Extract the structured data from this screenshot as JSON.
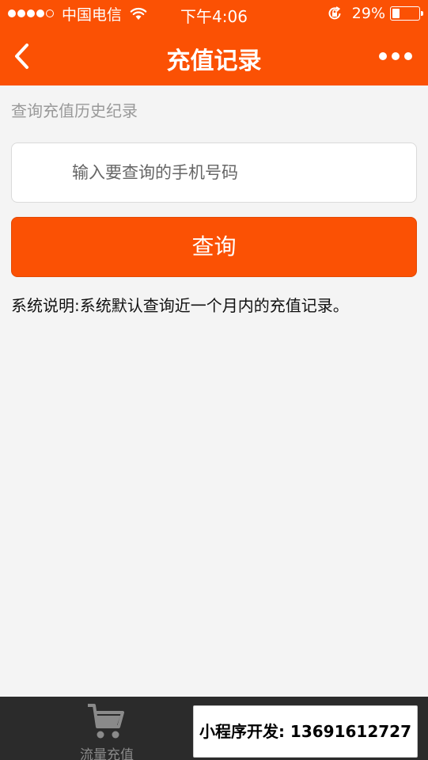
{
  "status_bar": {
    "carrier": "中国电信",
    "time": "下午4:06",
    "battery_percent": "29%",
    "battery_level": 0.29,
    "signal_bars": 4,
    "signal_total": 5
  },
  "nav": {
    "title": "充值记录",
    "back_icon": "chevron-left-icon",
    "more_icon": "more-dots-icon",
    "color": "#fb5104"
  },
  "main": {
    "subtitle": "查询充值历史纪录",
    "phone_input": {
      "placeholder": "输入要查询的手机号码",
      "value": ""
    },
    "query_button_label": "查询",
    "note": "系统说明:系统默认查询近一个月内的充值记录。"
  },
  "tabbar": {
    "tabs": [
      {
        "label": "流量充值",
        "icon": "cart-icon",
        "active": false
      },
      {
        "label": "",
        "icon": "record-icon",
        "active": true
      }
    ]
  },
  "promo": {
    "text": "小程序开发: 13691612727"
  }
}
